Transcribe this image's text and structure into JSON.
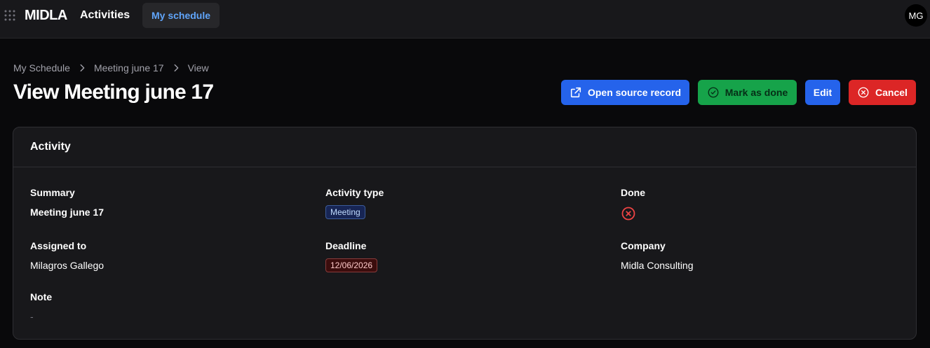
{
  "topbar": {
    "brand": "MIDLA",
    "nav_activities": "Activities",
    "nav_schedule": "My schedule",
    "avatar_initials": "MG"
  },
  "breadcrumb": [
    "My Schedule",
    "Meeting june 17",
    "View"
  ],
  "page_title": "View Meeting june 17",
  "actions": {
    "open_source": "Open source record",
    "mark_done": "Mark as done",
    "edit": "Edit",
    "cancel": "Cancel"
  },
  "card": {
    "title": "Activity",
    "fields": {
      "summary": {
        "label": "Summary",
        "value": "Meeting june 17"
      },
      "activity_type": {
        "label": "Activity type",
        "value": "Meeting"
      },
      "done": {
        "label": "Done",
        "icon": "x-circle-icon"
      },
      "assigned_to": {
        "label": "Assigned to",
        "value": "Milagros Gallego"
      },
      "deadline": {
        "label": "Deadline",
        "value": "12/06/2026"
      },
      "company": {
        "label": "Company",
        "value": "Midla Consulting"
      },
      "note": {
        "label": "Note",
        "value": "-"
      }
    }
  },
  "colors": {
    "primary": "#2563eb",
    "success": "#16a34a",
    "danger": "#dc2626",
    "background": "#09090b",
    "surface": "#18181b"
  }
}
